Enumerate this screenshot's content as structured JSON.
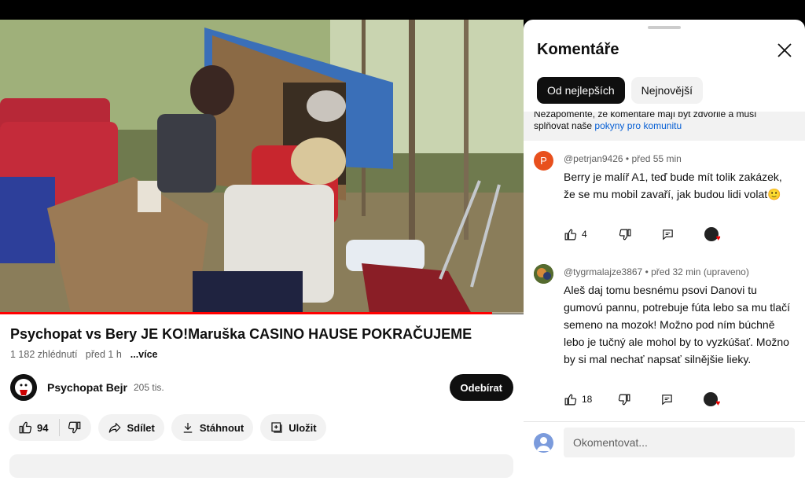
{
  "video": {
    "title": "Psychopat vs Bery JE KO!Maruška CASINO HAUSE POKRAČUJEME",
    "views": "1 182 zhlédnutí",
    "age": "před 1 h",
    "more_label": "...více",
    "progress": 0.94
  },
  "channel": {
    "name": "Psychopat Bejr",
    "subscribers": "205 tis.",
    "subscribe_label": "Odebírat"
  },
  "actions": {
    "like_count": "94",
    "share_label": "Sdílet",
    "download_label": "Stáhnout",
    "save_label": "Uložit"
  },
  "comments_panel": {
    "title": "Komentáře",
    "sort_chips": [
      "Od nejlepších",
      "Nejnovější"
    ],
    "notice_text": "Nezapomeňte, že komentáře mají být zdvořilé a musí splňovat naše",
    "notice_link": "pokyny pro komunitu",
    "items": [
      {
        "avatar_letter": "P",
        "avatar_color": "#e8501d",
        "author": "@petrjan9426",
        "time": "před 55 min",
        "text": "Berry je malíř A1, teď bude mít tolik zakázek, že se mu mobil zavaří, jak budou lidi volat🙂",
        "likes": "4"
      },
      {
        "avatar_letter": "",
        "avatar_color": "#556b2f",
        "author": "@tygrmalajze3867",
        "time": "před 32 min (upraveno)",
        "text": "Aleš daj tomu besnému psovi Danovi tu gumovú pannu, potrebuje fúta lebo sa mu tlačí semeno na mozok! Možno pod ním búchně lebo je tučný ale mohol by to vyzkúšať. Možno by si mal nechať napsať silnějšie lieky.",
        "likes": "18"
      }
    ],
    "input_placeholder": "Okomentovat..."
  }
}
